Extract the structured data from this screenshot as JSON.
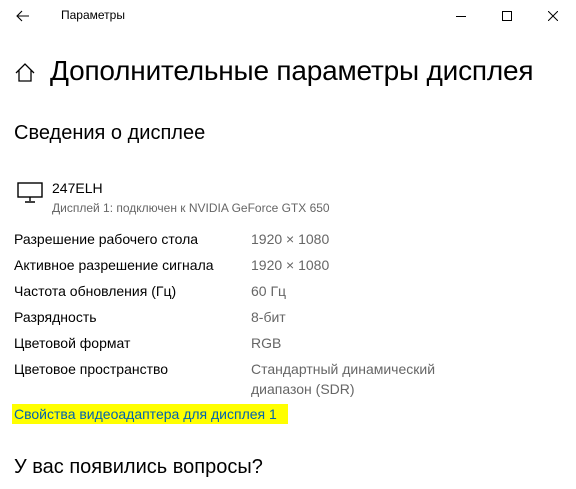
{
  "window": {
    "title": "Параметры"
  },
  "page": {
    "title": "Дополнительные параметры дисплея"
  },
  "display_info": {
    "section_title": "Сведения о дисплее",
    "monitor_name": "247ELH",
    "monitor_subtitle": "Дисплей 1: подключен к NVIDIA GeForce GTX 650",
    "rows": [
      {
        "label": "Разрешение рабочего стола",
        "value": "1920 × 1080"
      },
      {
        "label": "Активное разрешение сигнала",
        "value": "1920 × 1080"
      },
      {
        "label": "Частота обновления (Гц)",
        "value": "60 Гц"
      },
      {
        "label": "Разрядность",
        "value": "8-бит"
      },
      {
        "label": "Цветовой формат",
        "value": "RGB"
      },
      {
        "label": "Цветовое пространство",
        "value_line1": "Стандартный динамический",
        "value_line2": "диапазон (SDR)"
      }
    ],
    "adapter_link": "Свойства видеоадаптера для дисплея 1"
  },
  "questions": {
    "section_title": "У вас появились вопросы?"
  },
  "colors": {
    "link": "#0063b1",
    "highlight": "#ffff00",
    "secondary_text": "#666666"
  }
}
